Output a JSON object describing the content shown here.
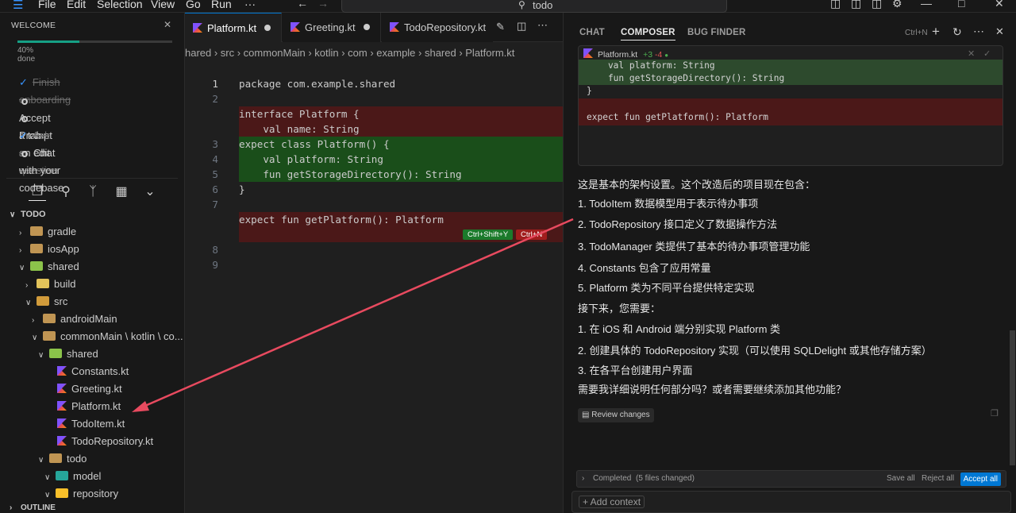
{
  "menu": [
    "File",
    "Edit",
    "Selection",
    "View",
    "Go",
    "Run",
    "···"
  ],
  "search": {
    "value": "todo"
  },
  "welcome": {
    "title": "WELCOME",
    "progress_label": "40% done",
    "progress_fraction": 0.4,
    "tasks": [
      {
        "label": "Finish onboarding",
        "done": true
      },
      {
        "label": "Accept a tab",
        "done": false
      },
      {
        "label": "Prompt an edit",
        "done": false
      },
      {
        "label": "Ask a question",
        "done": true
      },
      {
        "label": "Chat with your codebase",
        "done": false
      }
    ]
  },
  "explorer": {
    "root": "TODO",
    "items": [
      {
        "label": "gradle"
      },
      {
        "label": "iosApp"
      },
      {
        "label": "shared"
      },
      {
        "label": "build"
      },
      {
        "label": "src"
      },
      {
        "label": "androidMain"
      },
      {
        "label": "commonMain \\ kotlin \\ co..."
      },
      {
        "label": "shared"
      },
      {
        "label": "Constants.kt"
      },
      {
        "label": "Greeting.kt"
      },
      {
        "label": "Platform.kt"
      },
      {
        "label": "TodoItem.kt"
      },
      {
        "label": "TodoRepository.kt"
      },
      {
        "label": "todo"
      },
      {
        "label": "model"
      },
      {
        "label": "repository"
      }
    ],
    "outline": "OUTLINE"
  },
  "tabs": [
    "Platform.kt",
    "Greeting.kt",
    "TodoRepository.kt"
  ],
  "breadcrumb": "hared  › src  › commonMain  › kotlin  › com  › example  › shared  ›  Platform.kt",
  "code": [
    {
      "ln": "1",
      "text": "package com.example.shared",
      "kind": ""
    },
    {
      "ln": "2",
      "text": "",
      "kind": ""
    },
    {
      "ln": "",
      "text": "interface Platform {",
      "kind": "del"
    },
    {
      "ln": "",
      "text": "    val name: String",
      "kind": "del"
    },
    {
      "ln": "3",
      "text": "expect class Platform() {",
      "kind": "add"
    },
    {
      "ln": "4",
      "text": "    val platform: String",
      "kind": "add"
    },
    {
      "ln": "5",
      "text": "    fun getStorageDirectory(): String",
      "kind": "add"
    },
    {
      "ln": "6",
      "text": "}",
      "kind": ""
    },
    {
      "ln": "7",
      "text": "",
      "kind": ""
    },
    {
      "ln": "",
      "text": "expect fun getPlatform(): Platform",
      "kind": "del"
    },
    {
      "ln": "",
      "text": "",
      "kind": "del"
    },
    {
      "ln": "8",
      "text": "",
      "kind": ""
    },
    {
      "ln": "9",
      "text": "",
      "kind": ""
    }
  ],
  "badges": {
    "accept": "Ctrl+Shift+Y",
    "reject": "Ctrl+N"
  },
  "panel": {
    "tabs": [
      "CHAT",
      "COMPOSER",
      "BUG FINDER"
    ],
    "shortcut": "Ctrl+N",
    "diff_file": "Platform.kt",
    "diff_add": "+3",
    "diff_del": "-4",
    "diff_lines": [
      {
        "text": "    val platform: String",
        "kind": "add"
      },
      {
        "text": "    fun getStorageDirectory(): String",
        "kind": "add"
      },
      {
        "text": "}",
        "kind": ""
      },
      {
        "text": "",
        "kind": "del"
      },
      {
        "text": "expect fun getPlatform(): Platform",
        "kind": "del"
      }
    ],
    "messages": [
      "这是基本的架构设置。这个改造后的项目现在包含：",
      "1. TodoItem 数据模型用于表示待办事项",
      "2. TodoRepository 接口定义了数据操作方法",
      "3. TodoManager 类提供了基本的待办事项管理功能",
      "4. Constants 包含了应用常量",
      "5. Platform 类为不同平台提供特定实现",
      "接下来，您需要：",
      "1. 在 iOS 和 Android 端分别实现 Platform 类",
      "2. 创建具体的 TodoRepository 实现（可以使用 SQLDelight 或其他存储方案）",
      "3. 在各平台创建用户界面",
      "需要我详细说明任何部分吗？或者需要继续添加其他功能？"
    ],
    "review_label": "Review changes",
    "completed_label": "Completed",
    "completed_detail": "(5 files changed)",
    "save_all": "Save all",
    "reject_all": "Reject all",
    "accept_all": "Accept all",
    "add_context": "+ Add context"
  },
  "colors": {
    "accent": "#0078d4",
    "progress": "#16a085",
    "arrow": "#e84a5f"
  }
}
